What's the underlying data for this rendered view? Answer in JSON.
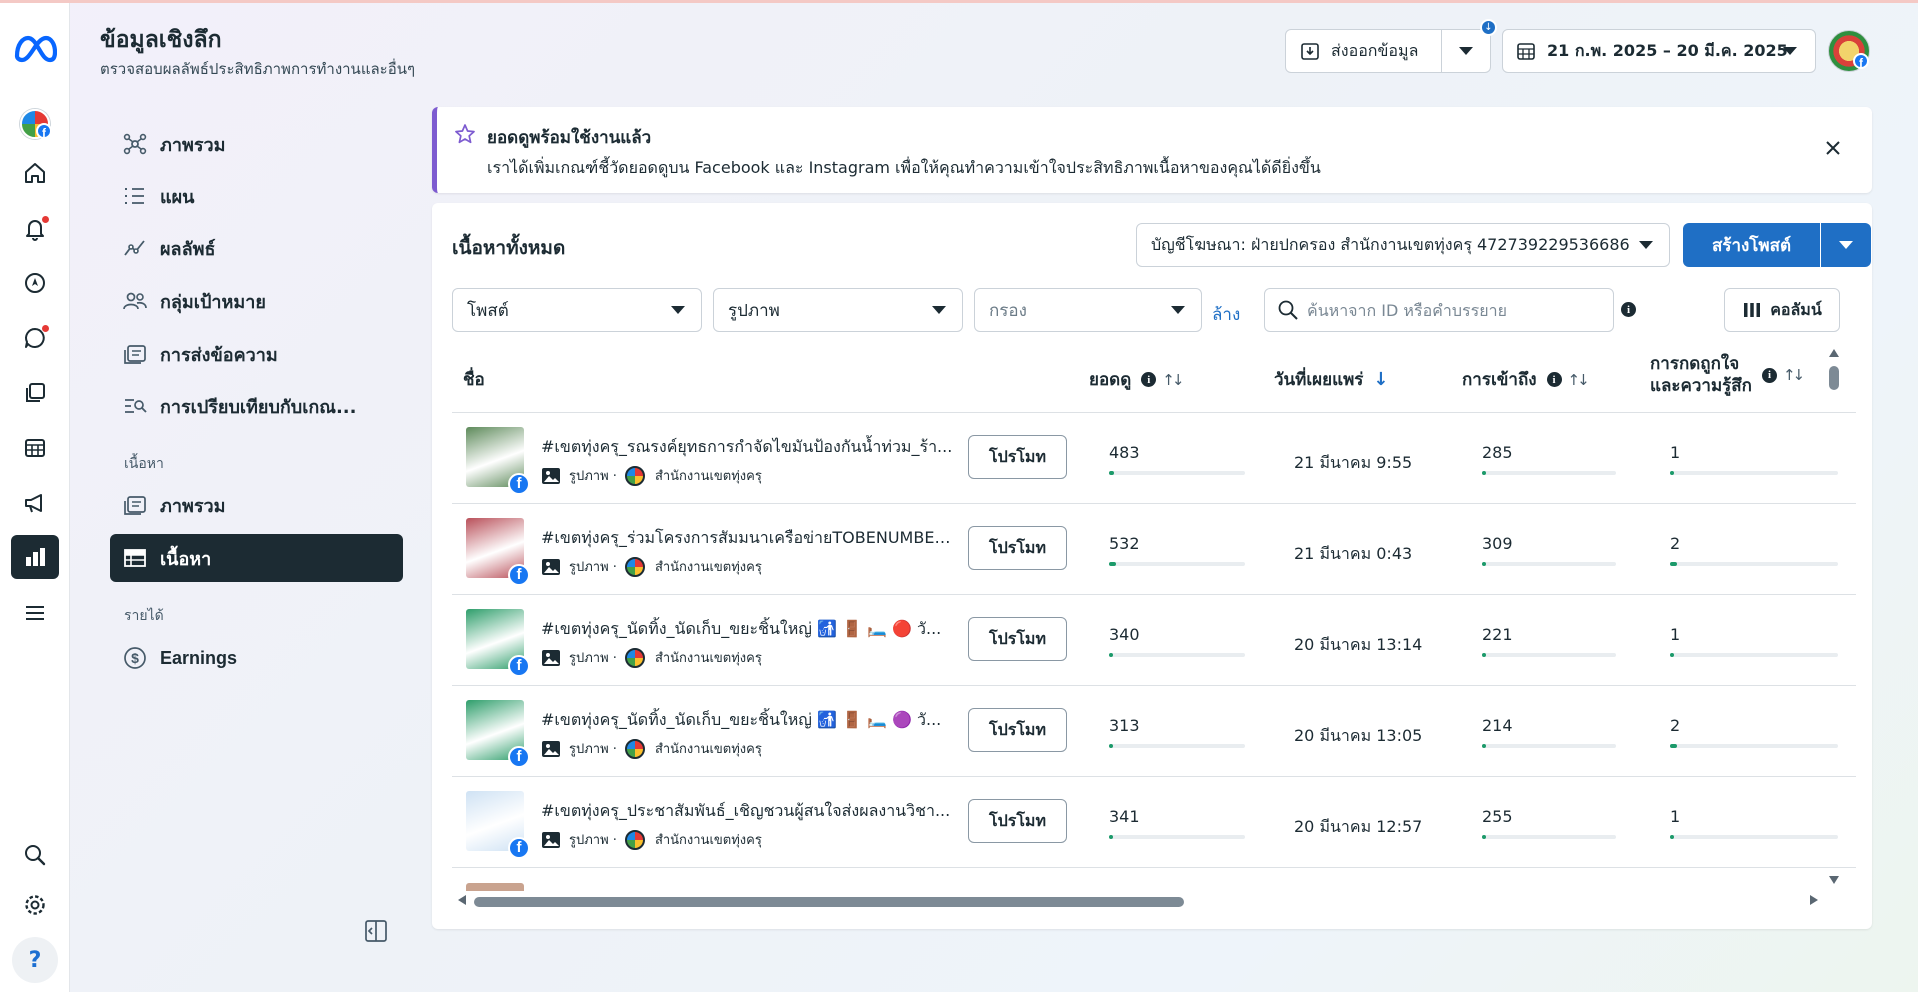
{
  "header": {
    "title": "ข้อมูลเชิงลึก",
    "subtitle": "ตรวจสอบผลลัพธ์ประสิทธิภาพการทำงานและอื่นๆ",
    "export_label": "ส่งออกข้อมูล",
    "date_range": "21 ก.พ. 2025 – 20 มี.ค. 2025"
  },
  "rail": {
    "icons": [
      "meta-logo",
      "page-avatar",
      "home-icon",
      "bell-icon",
      "compass-icon",
      "chat-icon",
      "pages-icon",
      "table-icon",
      "megaphone-icon",
      "insights-icon",
      "menu-icon",
      "search-icon",
      "settings-icon",
      "help-icon"
    ],
    "help_label": "?"
  },
  "nav": {
    "items": [
      {
        "label": "ภาพรวม"
      },
      {
        "label": "แผน"
      },
      {
        "label": "ผลลัพธ์"
      },
      {
        "label": "กลุ่มเป้าหมาย"
      },
      {
        "label": "การส่งข้อความ"
      },
      {
        "label": "การเปรียบเทียบกับเกณ..."
      }
    ],
    "content_section": "เนื้อหา",
    "content_items": [
      {
        "label": "ภาพรวม"
      },
      {
        "label": "เนื้อหา"
      }
    ],
    "revenue_section": "รายได้",
    "revenue_items": [
      {
        "label": "Earnings"
      }
    ]
  },
  "banner": {
    "title": "ยอดดูพร้อมใช้งานแล้ว",
    "body": "เราได้เพิ่มเกณฑ์ชี้วัดยอดดูบน Facebook และ Instagram เพื่อให้คุณทำความเข้าใจประสิทธิภาพเนื้อหาของคุณได้ดียิ่งขึ้น"
  },
  "content": {
    "title": "เนื้อหาทั้งหมด",
    "account_select": "บัญชีโฆษณา: ฝ่ายปกครอง สำนักงานเขตทุ่งครุ 472739229536686",
    "create_post": "สร้างโพสต์",
    "filters": {
      "type": "โพสต์",
      "format": "รูปภาพ",
      "filter_placeholder": "กรอง",
      "clear": "ล้าง",
      "search_placeholder": "ค้นหาจาก ID หรือคำบรรยาย",
      "columns": "คอลัมน์"
    },
    "columns": {
      "name": "ชื่อ",
      "views": "ยอดดู",
      "published": "วันที่เผยแพร่",
      "reach": "การเข้าถึง",
      "reactions_line1": "การกดถูกใจ",
      "reactions_line2": "และความรู้สึก"
    },
    "promote_label": "โปรโมท",
    "rows": [
      {
        "text": "#เขตทุ่งครุ_รณรงค์ยุทธการกำจัดไขมันป้องกันน้ำท่วม_ร้า...",
        "type": "รูปภาพ ·",
        "page": "สำนักงานเขตทุ่งครุ",
        "views": "483",
        "views_frac": 0.04,
        "date": "21 มีนาคม 9:55",
        "reach": "285",
        "reach_frac": 0.02,
        "reactions": "1",
        "reactions_frac": 0.02
      },
      {
        "text": "#เขตทุ่งครุ_ร่วมโครงการสัมมนาเครือข่ายTOBENUMBER...",
        "type": "รูปภาพ ·",
        "page": "สำนักงานเขตทุ่งครุ",
        "views": "532",
        "views_frac": 0.05,
        "date": "21 มีนาคม 0:43",
        "reach": "309",
        "reach_frac": 0.03,
        "reactions": "2",
        "reactions_frac": 0.04
      },
      {
        "text": "#เขตทุ่งครุ_นัดทิ้ง_นัดเก็บ_ขยะชิ้นใหญ่ 🚮 🚪 🛏️ 🔴 วั...",
        "type": "รูปภาพ ·",
        "page": "สำนักงานเขตทุ่งครุ",
        "views": "340",
        "views_frac": 0.02,
        "date": "20 มีนาคม 13:14",
        "reach": "221",
        "reach_frac": 0.02,
        "reactions": "1",
        "reactions_frac": 0.02
      },
      {
        "text": "#เขตทุ่งครุ_นัดทิ้ง_นัดเก็บ_ขยะชิ้นใหญ่ 🚮 🚪 🛏️ 🟣 วั...",
        "type": "รูปภาพ ·",
        "page": "สำนักงานเขตทุ่งครุ",
        "views": "313",
        "views_frac": 0.02,
        "date": "20 มีนาคม 13:05",
        "reach": "214",
        "reach_frac": 0.02,
        "reactions": "2",
        "reactions_frac": 0.04
      },
      {
        "text": "#เขตทุ่งครุ_ประชาสัมพันธ์_เชิญชวนผู้สนใจส่งผลงานวิชา...",
        "type": "รูปภาพ ·",
        "page": "สำนักงานเขตทุ่งครุ",
        "views": "341",
        "views_frac": 0.02,
        "date": "20 มีนาคม 12:57",
        "reach": "255",
        "reach_frac": 0.02,
        "reactions": "1",
        "reactions_frac": 0.02
      }
    ],
    "thumb_colors": [
      "#5d8a5a",
      "#b9505a",
      "#2e9e6b",
      "#2e9e6b",
      "#cfe2f4"
    ]
  },
  "colors": {
    "accent": "#1f6fc5",
    "dark": "#1c2b33",
    "banner_accent": "#7d5bd0",
    "bar": "#1c9a6a"
  }
}
